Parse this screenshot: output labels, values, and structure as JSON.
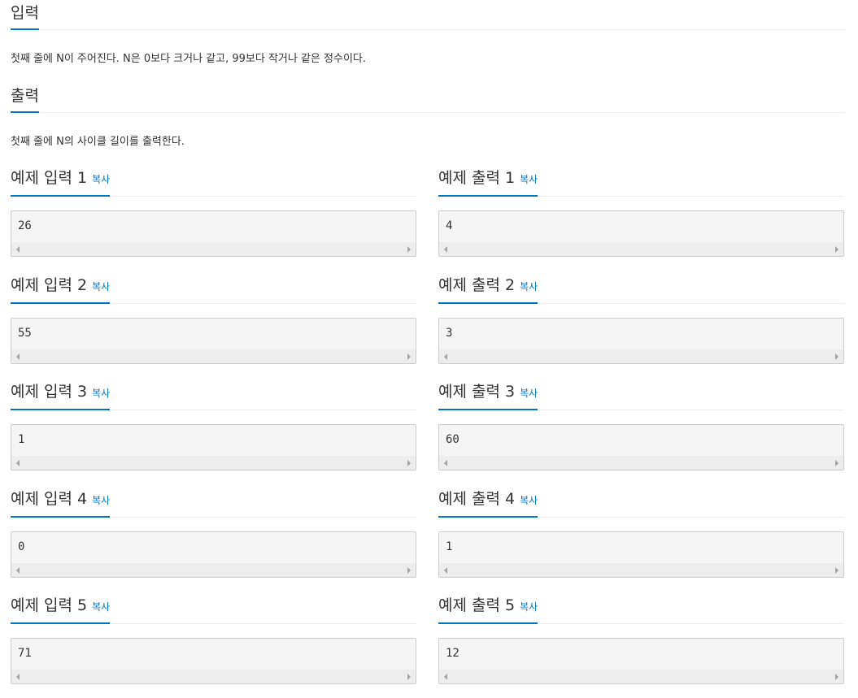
{
  "input_section": {
    "title": "입력",
    "description": "첫째 줄에 N이 주어진다. N은 0보다 크거나 같고, 99보다 작거나 같은 정수이다."
  },
  "output_section": {
    "title": "출력",
    "description": "첫째 줄에 N의 사이클 길이를 출력한다."
  },
  "copy_label": "복사",
  "samples": [
    {
      "input_title": "예제 입력 1",
      "input_value": "26",
      "output_title": "예제 출력 1",
      "output_value": "4"
    },
    {
      "input_title": "예제 입력 2",
      "input_value": "55",
      "output_title": "예제 출력 2",
      "output_value": "3"
    },
    {
      "input_title": "예제 입력 3",
      "input_value": "1",
      "output_title": "예제 출력 3",
      "output_value": "60"
    },
    {
      "input_title": "예제 입력 4",
      "input_value": "0",
      "output_title": "예제 출력 4",
      "output_value": "1"
    },
    {
      "input_title": "예제 입력 5",
      "input_value": "71",
      "output_title": "예제 출력 5",
      "output_value": "12"
    }
  ]
}
